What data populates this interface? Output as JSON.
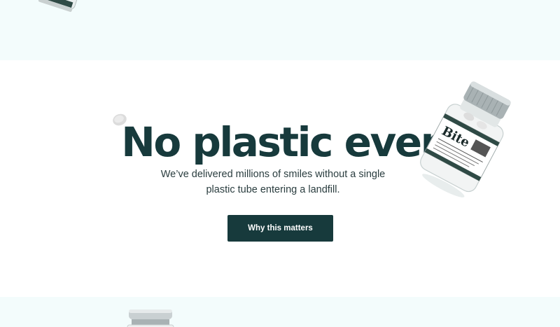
{
  "hero": {
    "headline": "No plastic ever",
    "subtext": "We’ve delivered millions of smiles without a single plastic tube entering a landfill.",
    "cta_label": "Why this matters"
  },
  "jar": {
    "brand": "Bite"
  },
  "colors": {
    "primary": "#173a3c",
    "band_background": "#f3fcfc",
    "page_background": "#ffffff"
  },
  "icons": [
    "glass-jar-image",
    "tablet-image"
  ]
}
